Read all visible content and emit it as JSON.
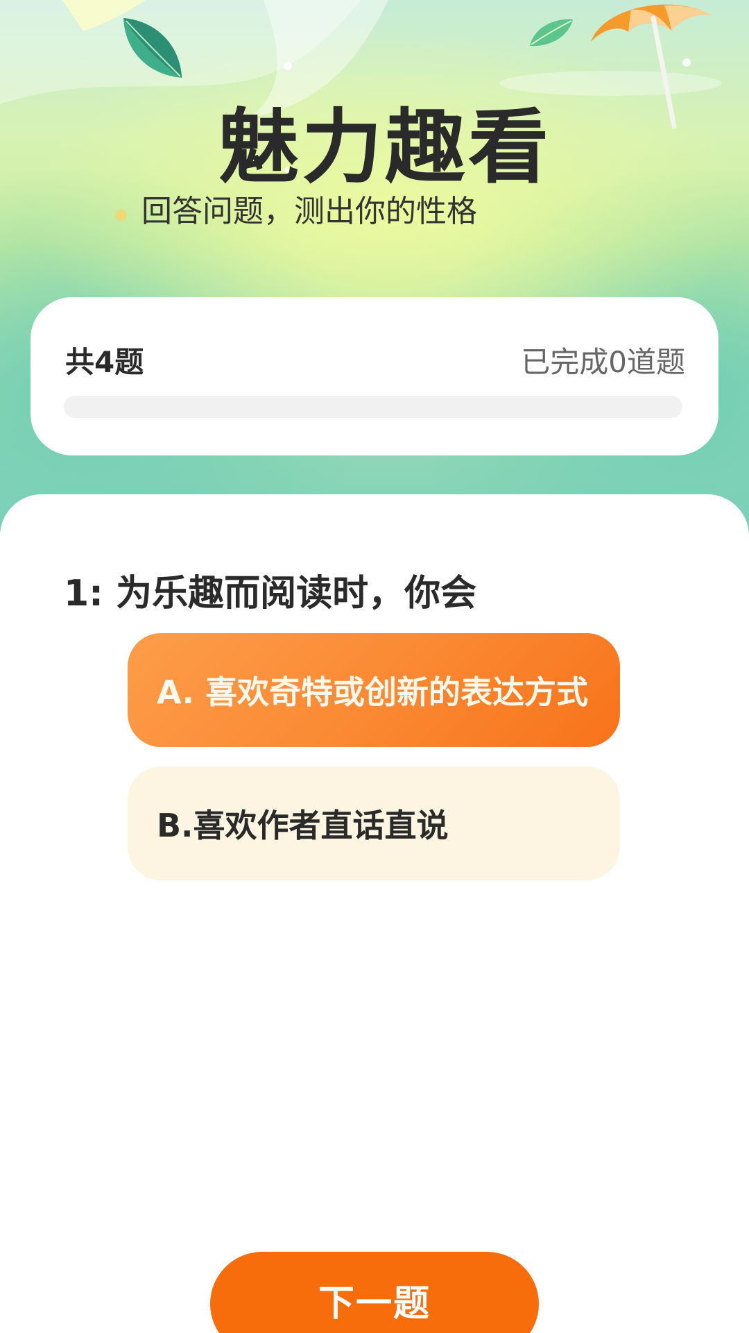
{
  "header": {
    "title": "魅力趣看",
    "subtitle": "回答问题，测出你的性格"
  },
  "progress": {
    "total_label": "共4题",
    "done_label": "已完成0道题",
    "completed": 0,
    "total": 4
  },
  "quiz": {
    "question": "1: 为乐趣而阅读时，你会",
    "options": [
      {
        "label": "A. 喜欢奇特或创新的表达方式",
        "selected": true
      },
      {
        "label": "B.喜欢作者直话直说",
        "selected": false
      }
    ],
    "next_label": "下一题"
  },
  "colors": {
    "accent": "#f76d0c",
    "option_selected_start": "#fd9d4a",
    "option_selected_end": "#f7731a",
    "option_unselected": "#fdf5e1",
    "text_dark": "#2a2a2a"
  },
  "icons": {
    "decorations": [
      "leaf-icon",
      "leaf-icon",
      "umbrella-icon"
    ]
  }
}
